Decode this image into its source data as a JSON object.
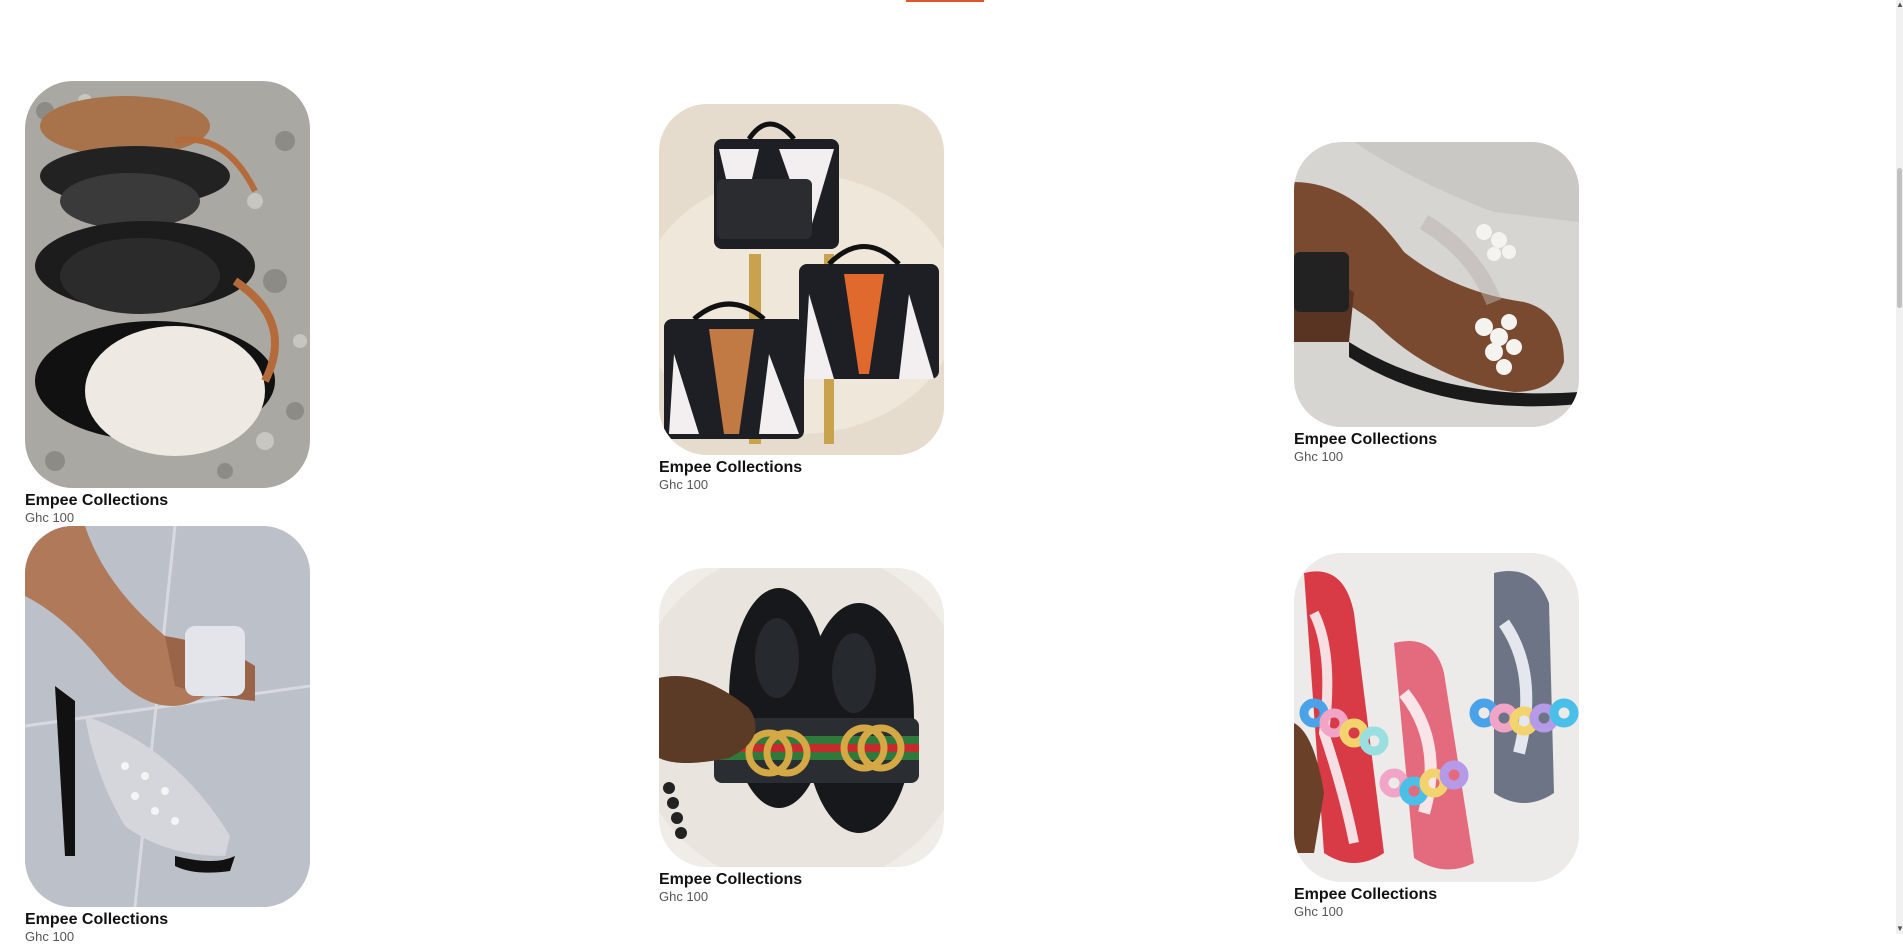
{
  "colors": {
    "accent": "#d9572f"
  },
  "products": [
    {
      "name": "Empee Collections",
      "price": "Ghc 100",
      "image": "fluffy-monogram-slides"
    },
    {
      "name": "Empee Collections",
      "price": "Ghc 100",
      "image": "tricolor-handbag-set"
    },
    {
      "name": "Empee Collections",
      "price": "Ghc 100",
      "image": "pearl-strap-heeled-mule"
    },
    {
      "name": "Empee Collections",
      "price": "Ghc 100",
      "image": "rhinestone-heeled-mule"
    },
    {
      "name": "Empee Collections",
      "price": "Ghc 100",
      "image": "gg-stripe-slides"
    },
    {
      "name": "Empee Collections",
      "price": "Ghc 100",
      "image": "tie-dye-chain-slides"
    }
  ]
}
